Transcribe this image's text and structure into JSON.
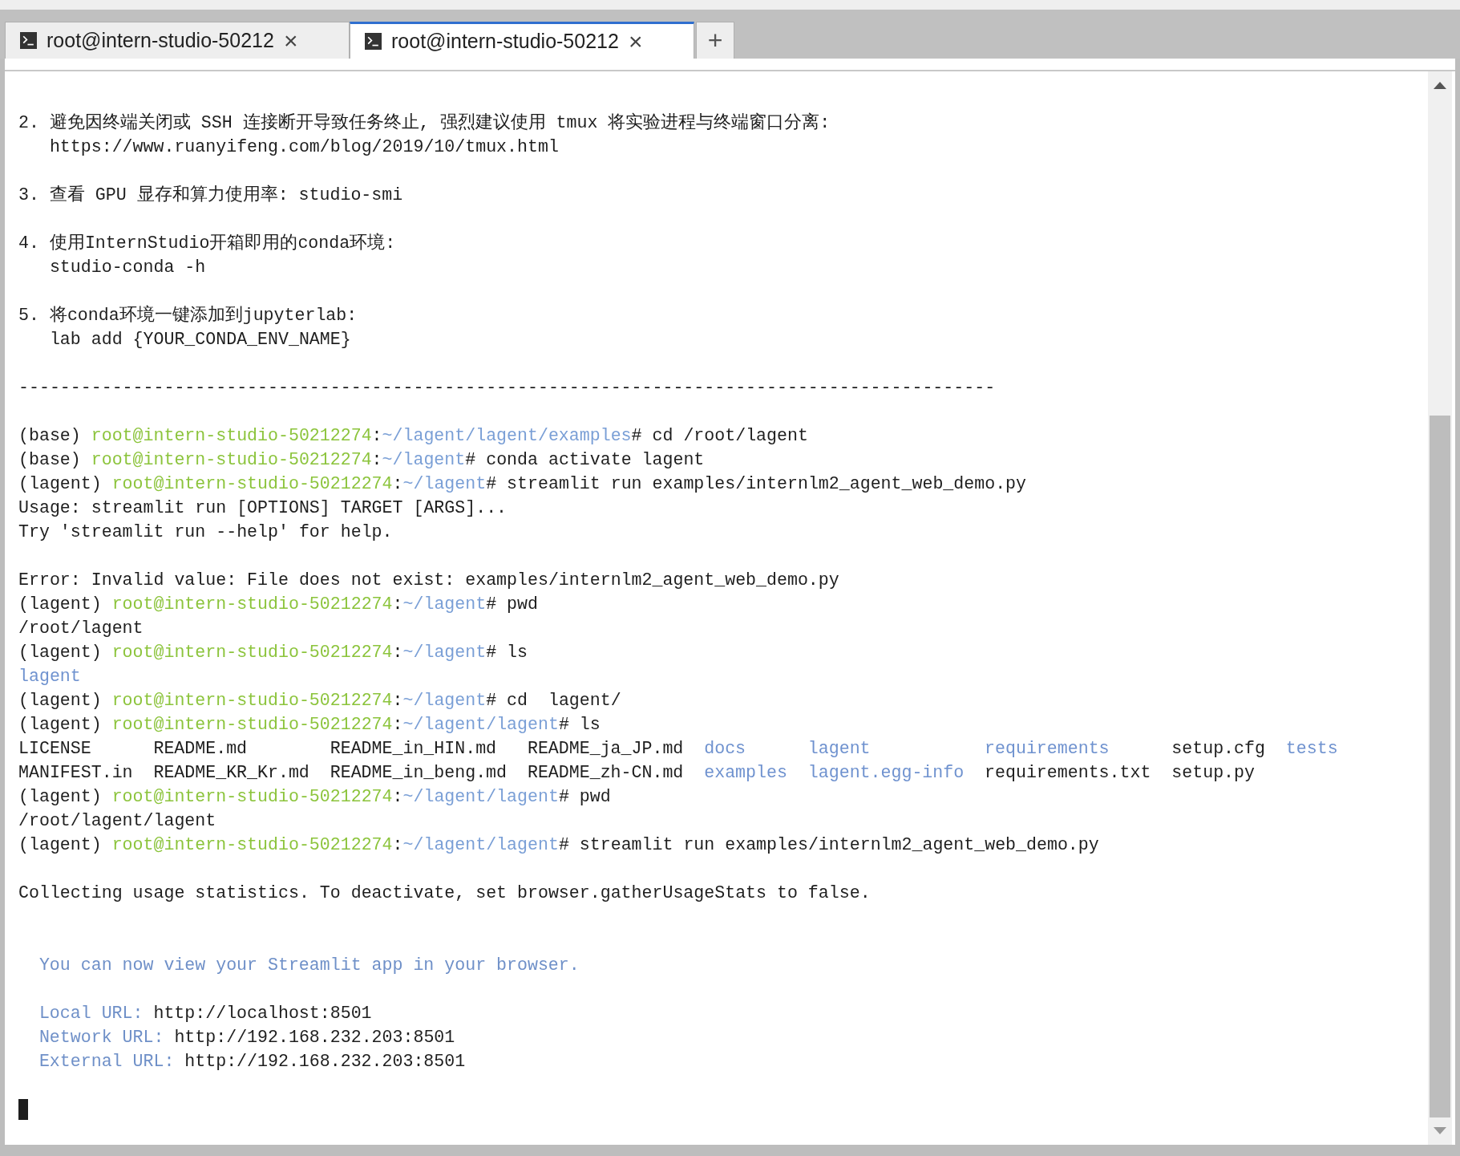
{
  "tabs": [
    {
      "title": "root@intern-studio-50212",
      "close": "×",
      "selected": false
    },
    {
      "title": "root@intern-studio-50212",
      "close": "×",
      "selected": true
    }
  ],
  "new_tab": "+",
  "terminal": {
    "lines": [
      {
        "kind": "text",
        "segments": [
          {
            "kind": "plain",
            "text": "2. 避免因终端关闭或 SSH 连接断开导致任务终止, 强烈建议使用 tmux 将实验进程与终端窗口分离:"
          }
        ]
      },
      {
        "kind": "item_text",
        "segments": [
          {
            "kind": "plain",
            "text": "https://www.ruanyifeng.com/blog/2019/10/tmux.html"
          }
        ]
      },
      {
        "kind": "blank"
      },
      {
        "kind": "text",
        "segments": [
          {
            "kind": "plain",
            "text": "3. 查看 GPU 显存和算力使用率: studio-smi"
          }
        ]
      },
      {
        "kind": "blank"
      },
      {
        "kind": "text",
        "segments": [
          {
            "kind": "plain",
            "text": "4. 使用InternStudio开箱即用的conda环境:"
          }
        ]
      },
      {
        "kind": "item_text",
        "segments": [
          {
            "kind": "plain",
            "text": "studio-conda -h"
          }
        ]
      },
      {
        "kind": "blank"
      },
      {
        "kind": "text",
        "segments": [
          {
            "kind": "plain",
            "text": "5. 将conda环境一键添加到jupyterlab:"
          }
        ]
      },
      {
        "kind": "item_text",
        "segments": [
          {
            "kind": "plain",
            "text": "lab add {YOUR_CONDA_ENV_NAME}"
          }
        ]
      },
      {
        "kind": "blank"
      },
      {
        "kind": "rule",
        "text": "----------------------------------------------------------------------------------------------"
      },
      {
        "kind": "blank"
      },
      {
        "kind": "text",
        "segments": [
          {
            "kind": "plain",
            "text": "(base) "
          },
          {
            "kind": "host",
            "text": "root@intern-studio-50212274"
          },
          {
            "kind": "plain",
            "text": ":"
          },
          {
            "kind": "path",
            "text": "~/lagent/lagent/examples"
          },
          {
            "kind": "plain",
            "text": "# cd /root/lagent"
          }
        ]
      },
      {
        "kind": "text",
        "segments": [
          {
            "kind": "plain",
            "text": "(base) "
          },
          {
            "kind": "host",
            "text": "root@intern-studio-50212274"
          },
          {
            "kind": "plain",
            "text": ":"
          },
          {
            "kind": "path",
            "text": "~/lagent"
          },
          {
            "kind": "plain",
            "text": "# conda activate lagent"
          }
        ]
      },
      {
        "kind": "text",
        "segments": [
          {
            "kind": "plain",
            "text": "(lagent) "
          },
          {
            "kind": "host",
            "text": "root@intern-studio-50212274"
          },
          {
            "kind": "plain",
            "text": ":"
          },
          {
            "kind": "path",
            "text": "~/lagent"
          },
          {
            "kind": "plain",
            "text": "# streamlit run examples/internlm2_agent_web_demo.py"
          }
        ]
      },
      {
        "kind": "text",
        "segments": [
          {
            "kind": "plain",
            "text": "Usage: streamlit run [OPTIONS] TARGET [ARGS]..."
          }
        ]
      },
      {
        "kind": "text",
        "segments": [
          {
            "kind": "plain",
            "text": "Try 'streamlit run --help' for help."
          }
        ]
      },
      {
        "kind": "blank"
      },
      {
        "kind": "text",
        "segments": [
          {
            "kind": "plain",
            "text": "Error: Invalid value: File does not exist: examples/internlm2_agent_web_demo.py"
          }
        ]
      },
      {
        "kind": "text",
        "segments": [
          {
            "kind": "plain",
            "text": "(lagent) "
          },
          {
            "kind": "host",
            "text": "root@intern-studio-50212274"
          },
          {
            "kind": "plain",
            "text": ":"
          },
          {
            "kind": "path",
            "text": "~/lagent"
          },
          {
            "kind": "plain",
            "text": "# pwd"
          }
        ]
      },
      {
        "kind": "text",
        "segments": [
          {
            "kind": "plain",
            "text": "/root/lagent"
          }
        ]
      },
      {
        "kind": "text",
        "segments": [
          {
            "kind": "plain",
            "text": "(lagent) "
          },
          {
            "kind": "host",
            "text": "root@intern-studio-50212274"
          },
          {
            "kind": "plain",
            "text": ":"
          },
          {
            "kind": "path",
            "text": "~/lagent"
          },
          {
            "kind": "plain",
            "text": "# ls"
          }
        ]
      },
      {
        "kind": "text",
        "segments": [
          {
            "kind": "dir",
            "text": "lagent"
          }
        ]
      },
      {
        "kind": "text",
        "segments": [
          {
            "kind": "plain",
            "text": "(lagent) "
          },
          {
            "kind": "host",
            "text": "root@intern-studio-50212274"
          },
          {
            "kind": "plain",
            "text": ":"
          },
          {
            "kind": "path",
            "text": "~/lagent"
          },
          {
            "kind": "plain",
            "text": "# cd  lagent/"
          }
        ]
      },
      {
        "kind": "text",
        "segments": [
          {
            "kind": "plain",
            "text": "(lagent) "
          },
          {
            "kind": "host",
            "text": "root@intern-studio-50212274"
          },
          {
            "kind": "plain",
            "text": ":"
          },
          {
            "kind": "path",
            "text": "~/lagent/lagent"
          },
          {
            "kind": "plain",
            "text": "# ls"
          }
        ]
      },
      {
        "kind": "listing",
        "entries": [
          {
            "name": "LICENSE",
            "kind": "file"
          },
          {
            "name": "README.md",
            "kind": "file"
          },
          {
            "name": "README_in_HIN.md",
            "kind": "file"
          },
          {
            "name": "README_ja_JP.md",
            "kind": "file"
          },
          {
            "name": "docs",
            "kind": "dir"
          },
          {
            "name": "lagent",
            "kind": "dir"
          },
          {
            "name": "requirements",
            "kind": "dir"
          },
          {
            "name": "setup.cfg",
            "kind": "file"
          },
          {
            "name": "tests",
            "kind": "dir"
          }
        ]
      },
      {
        "kind": "listing",
        "entries": [
          {
            "name": "MANIFEST.in",
            "kind": "file"
          },
          {
            "name": "README_KR_Kr.md",
            "kind": "file"
          },
          {
            "name": "README_in_beng.md",
            "kind": "file"
          },
          {
            "name": "README_zh-CN.md",
            "kind": "file"
          },
          {
            "name": "examples",
            "kind": "dir"
          },
          {
            "name": "lagent.egg-info",
            "kind": "dir"
          },
          {
            "name": "requirements.txt",
            "kind": "file"
          },
          {
            "name": "setup.py",
            "kind": "file"
          }
        ]
      },
      {
        "kind": "text",
        "segments": [
          {
            "kind": "plain",
            "text": "(lagent) "
          },
          {
            "kind": "host",
            "text": "root@intern-studio-50212274"
          },
          {
            "kind": "plain",
            "text": ":"
          },
          {
            "kind": "path",
            "text": "~/lagent/lagent"
          },
          {
            "kind": "plain",
            "text": "# pwd"
          }
        ]
      },
      {
        "kind": "text",
        "segments": [
          {
            "kind": "plain",
            "text": "/root/lagent/lagent"
          }
        ]
      },
      {
        "kind": "text",
        "segments": [
          {
            "kind": "plain",
            "text": "(lagent) "
          },
          {
            "kind": "host",
            "text": "root@intern-studio-50212274"
          },
          {
            "kind": "plain",
            "text": ":"
          },
          {
            "kind": "path",
            "text": "~/lagent/lagent"
          },
          {
            "kind": "plain",
            "text": "# streamlit run examples/internlm2_agent_web_demo.py"
          }
        ]
      },
      {
        "kind": "blank"
      },
      {
        "kind": "text",
        "segments": [
          {
            "kind": "plain",
            "text": "Collecting usage statistics. To deactivate, set browser.gatherUsageStats to false."
          }
        ]
      },
      {
        "kind": "blank"
      },
      {
        "kind": "blank"
      },
      {
        "kind": "block_text",
        "segments": [
          {
            "kind": "note",
            "text": "You can now view your Streamlit app in your browser."
          }
        ]
      },
      {
        "kind": "blank"
      },
      {
        "kind": "block_text",
        "segments": [
          {
            "kind": "note",
            "text": "Local URL: "
          },
          {
            "kind": "plain",
            "text": "http://localhost:8501"
          }
        ]
      },
      {
        "kind": "block_text",
        "segments": [
          {
            "kind": "note",
            "text": "Network URL: "
          },
          {
            "kind": "plain",
            "text": "http://192.168.232.203:8501"
          }
        ]
      },
      {
        "kind": "block_text",
        "segments": [
          {
            "kind": "note",
            "text": "External URL: "
          },
          {
            "kind": "plain",
            "text": "http://192.168.232.203:8501"
          }
        ]
      },
      {
        "kind": "blank"
      },
      {
        "kind": "cursor"
      }
    ]
  }
}
